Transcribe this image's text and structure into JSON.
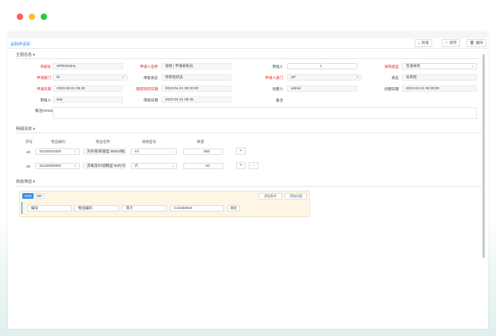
{
  "window": {
    "title": "采购申请单"
  },
  "toolbar": {
    "new_label": "新增",
    "save_label": "保存",
    "delete_label": "删除"
  },
  "sections": {
    "main": "主题信息",
    "detail": "明细清单",
    "filter": "高级筛选"
  },
  "form": {
    "doc_no": {
      "label": "单据号",
      "value": "SPD0018AL"
    },
    "applicant_name": {
      "label": "申请人名称",
      "value": "张晓 | 申请采购员"
    },
    "approver": {
      "label": "审批人",
      "value": "1"
    },
    "purchase_type": {
      "label": "采购类型",
      "value": "普通采购"
    },
    "apply_dept": {
      "label": "申请部门",
      "value": "bt"
    },
    "approval_status": {
      "label": "审批状态",
      "value": "待审批状态"
    },
    "applicant_dept": {
      "label": "申请人部门",
      "value": "ZP"
    },
    "apply_status": {
      "label": "状态",
      "value": "未审批"
    },
    "apply_date": {
      "label": "申请日期",
      "value": "2023-04-21 09:40"
    },
    "expect_date": {
      "label": "期望到货日期",
      "value": "2023-04-21 09:30:00"
    },
    "creator": {
      "label": "创建人",
      "value": "admin"
    },
    "create_date": {
      "label": "创建日期",
      "value": "2023-04-21 09:30:00"
    },
    "reviewer": {
      "label": "审核人",
      "value": "test"
    },
    "review_date": {
      "label": "审核日期",
      "value": "2023-04-21 09:45"
    },
    "remark_label": {
      "label": "备注",
      "value": ""
    },
    "remark": {
      "label": "备注(remark)",
      "value": ""
    }
  },
  "detail": {
    "columns": [
      "序号",
      "物品编码",
      "物品名称",
      "规格型号",
      "数量"
    ],
    "rows": [
      {
        "no": "10",
        "code": "10120010300",
        "name": "洗手液/抑菌型 500ml/瓶",
        "spec": "ml",
        "qty": "500"
      },
      {
        "no": "20",
        "code": "10120069300",
        "name": "消毒湿巾/酒精型 80片/包",
        "spec": "片",
        "qty": "60"
      }
    ]
  },
  "filter": {
    "and_label": "AND",
    "or_label": "OR",
    "add_condition_label": "添加条件",
    "add_group_label": "添加分组",
    "field": "编号",
    "field2": "物品编码",
    "operator": "等于",
    "value": "C41000020",
    "delete_label": "删除"
  },
  "colors": {
    "accent": "#2d8cf0",
    "required": "#e02020",
    "dot_red": "#ff5f57",
    "dot_yellow": "#febc2e",
    "dot_green": "#28c840"
  }
}
